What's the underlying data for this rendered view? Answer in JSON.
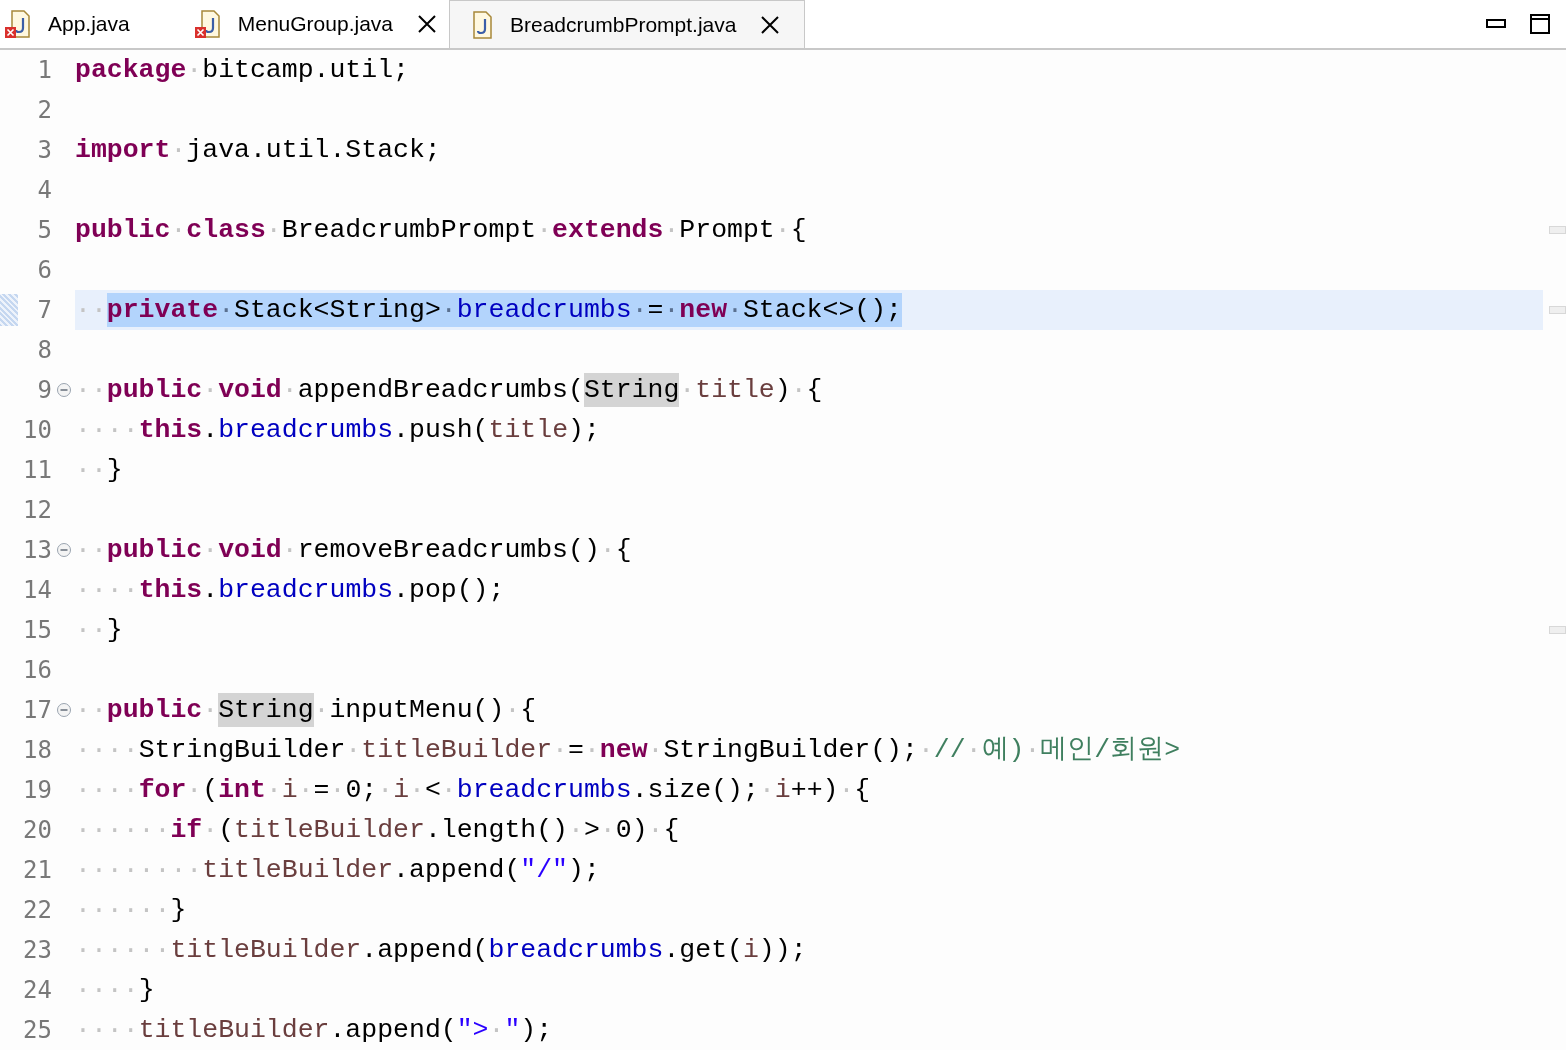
{
  "tabs": [
    {
      "label": "App.java",
      "selected": false,
      "error": true,
      "closable": false
    },
    {
      "label": "MenuGroup.java",
      "selected": false,
      "error": true,
      "closable": true
    },
    {
      "label": "BreadcrumbPrompt.java",
      "selected": true,
      "error": false,
      "closable": true
    }
  ],
  "lines": [
    {
      "number": "1",
      "tokens": [
        {
          "text": "package",
          "kind": "keyword"
        },
        {
          "text": "·",
          "kind": "ws"
        },
        {
          "text": "bitcamp.util;",
          "kind": "plain"
        }
      ]
    },
    {
      "number": "2"
    },
    {
      "number": "3",
      "tokens": [
        {
          "text": "import",
          "kind": "keyword"
        },
        {
          "text": "·",
          "kind": "ws"
        },
        {
          "text": "java.util.Stack;",
          "kind": "plain"
        }
      ]
    },
    {
      "number": "4"
    },
    {
      "number": "5",
      "ruler_mark": true,
      "tokens": [
        {
          "text": "public",
          "kind": "keyword"
        },
        {
          "text": "·",
          "kind": "ws"
        },
        {
          "text": "class",
          "kind": "keyword"
        },
        {
          "text": "·",
          "kind": "ws"
        },
        {
          "text": "BreadcrumbPrompt",
          "kind": "plain"
        },
        {
          "text": "·",
          "kind": "ws"
        },
        {
          "text": "extends",
          "kind": "keyword"
        },
        {
          "text": "·",
          "kind": "ws"
        },
        {
          "text": "Prompt",
          "kind": "plain"
        },
        {
          "text": "·",
          "kind": "ws"
        },
        {
          "text": "{",
          "kind": "plain"
        }
      ]
    },
    {
      "number": "6"
    },
    {
      "number": "7",
      "current": true,
      "ruler_mark": true,
      "tokens": [
        {
          "text": "··",
          "kind": "ws"
        },
        {
          "text": "private",
          "kind": "keyword",
          "selected": true
        },
        {
          "text": "·",
          "kind": "ws",
          "selected": true
        },
        {
          "text": "Stack<String>",
          "kind": "plain",
          "selected": true
        },
        {
          "text": "·",
          "kind": "ws",
          "selected": true
        },
        {
          "text": "breadcrumbs",
          "kind": "field",
          "selected": true
        },
        {
          "text": "·",
          "kind": "ws",
          "selected": true
        },
        {
          "text": "=",
          "kind": "plain",
          "selected": true
        },
        {
          "text": "·",
          "kind": "ws",
          "selected": true
        },
        {
          "text": "new",
          "kind": "keyword",
          "selected": true
        },
        {
          "text": "·",
          "kind": "ws",
          "selected": true
        },
        {
          "text": "Stack<>();",
          "kind": "plain",
          "selected": true
        }
      ]
    },
    {
      "number": "8"
    },
    {
      "number": "9",
      "fold": {
        "expanded": true
      },
      "tokens": [
        {
          "text": "··",
          "kind": "ws"
        },
        {
          "text": "public",
          "kind": "keyword"
        },
        {
          "text": "·",
          "kind": "ws"
        },
        {
          "text": "void",
          "kind": "keyword"
        },
        {
          "text": "·",
          "kind": "ws"
        },
        {
          "text": "appendBreadcrumbs(",
          "kind": "plain"
        },
        {
          "text": "String",
          "kind": "plain",
          "occurrence": true
        },
        {
          "text": "·",
          "kind": "ws"
        },
        {
          "text": "title",
          "kind": "local"
        },
        {
          "text": ")",
          "kind": "plain"
        },
        {
          "text": "·",
          "kind": "ws"
        },
        {
          "text": "{",
          "kind": "plain"
        }
      ]
    },
    {
      "number": "10",
      "tokens": [
        {
          "text": "····",
          "kind": "ws"
        },
        {
          "text": "this",
          "kind": "keyword"
        },
        {
          "text": ".",
          "kind": "plain"
        },
        {
          "text": "breadcrumbs",
          "kind": "field"
        },
        {
          "text": ".push(",
          "kind": "plain"
        },
        {
          "text": "title",
          "kind": "local"
        },
        {
          "text": ");",
          "kind": "plain"
        }
      ]
    },
    {
      "number": "11",
      "tokens": [
        {
          "text": "··",
          "kind": "ws"
        },
        {
          "text": "}",
          "kind": "plain"
        }
      ]
    },
    {
      "number": "12"
    },
    {
      "number": "13",
      "fold": {
        "expanded": true
      },
      "tokens": [
        {
          "text": "··",
          "kind": "ws"
        },
        {
          "text": "public",
          "kind": "keyword"
        },
        {
          "text": "·",
          "kind": "ws"
        },
        {
          "text": "void",
          "kind": "keyword"
        },
        {
          "text": "·",
          "kind": "ws"
        },
        {
          "text": "removeBreadcrumbs()",
          "kind": "plain"
        },
        {
          "text": "·",
          "kind": "ws"
        },
        {
          "text": "{",
          "kind": "plain"
        }
      ]
    },
    {
      "number": "14",
      "tokens": [
        {
          "text": "····",
          "kind": "ws"
        },
        {
          "text": "this",
          "kind": "keyword"
        },
        {
          "text": ".",
          "kind": "plain"
        },
        {
          "text": "breadcrumbs",
          "kind": "field"
        },
        {
          "text": ".pop();",
          "kind": "plain"
        }
      ]
    },
    {
      "number": "15",
      "ruler_mark": true,
      "tokens": [
        {
          "text": "··",
          "kind": "ws"
        },
        {
          "text": "}",
          "kind": "plain"
        }
      ]
    },
    {
      "number": "16"
    },
    {
      "number": "17",
      "fold": {
        "expanded": true
      },
      "tokens": [
        {
          "text": "··",
          "kind": "ws"
        },
        {
          "text": "public",
          "kind": "keyword"
        },
        {
          "text": "·",
          "kind": "ws"
        },
        {
          "text": "String",
          "kind": "plain",
          "occurrence": true
        },
        {
          "text": "·",
          "kind": "ws"
        },
        {
          "text": "inputMenu()",
          "kind": "plain"
        },
        {
          "text": "·",
          "kind": "ws"
        },
        {
          "text": "{",
          "kind": "plain"
        }
      ]
    },
    {
      "number": "18",
      "tokens": [
        {
          "text": "····",
          "kind": "ws"
        },
        {
          "text": "StringBuilder",
          "kind": "plain"
        },
        {
          "text": "·",
          "kind": "ws"
        },
        {
          "text": "titleBuilder",
          "kind": "local"
        },
        {
          "text": "·",
          "kind": "ws"
        },
        {
          "text": "=",
          "kind": "plain"
        },
        {
          "text": "·",
          "kind": "ws"
        },
        {
          "text": "new",
          "kind": "keyword"
        },
        {
          "text": "·",
          "kind": "ws"
        },
        {
          "text": "StringBuilder();",
          "kind": "plain"
        },
        {
          "text": "·",
          "kind": "ws"
        },
        {
          "text": "//",
          "kind": "comment"
        },
        {
          "text": "·",
          "kind": "ws"
        },
        {
          "text": "예)",
          "kind": "comment"
        },
        {
          "text": "·",
          "kind": "ws"
        },
        {
          "text": "메인/회원>",
          "kind": "comment"
        }
      ]
    },
    {
      "number": "19",
      "tokens": [
        {
          "text": "····",
          "kind": "ws"
        },
        {
          "text": "for",
          "kind": "keyword"
        },
        {
          "text": "·",
          "kind": "ws"
        },
        {
          "text": "(",
          "kind": "plain"
        },
        {
          "text": "int",
          "kind": "keyword"
        },
        {
          "text": "·",
          "kind": "ws"
        },
        {
          "text": "i",
          "kind": "local"
        },
        {
          "text": "·",
          "kind": "ws"
        },
        {
          "text": "=",
          "kind": "plain"
        },
        {
          "text": "·",
          "kind": "ws"
        },
        {
          "text": "0;",
          "kind": "plain"
        },
        {
          "text": "·",
          "kind": "ws"
        },
        {
          "text": "i",
          "kind": "local"
        },
        {
          "text": "·",
          "kind": "ws"
        },
        {
          "text": "<",
          "kind": "plain"
        },
        {
          "text": "·",
          "kind": "ws"
        },
        {
          "text": "breadcrumbs",
          "kind": "field"
        },
        {
          "text": ".size();",
          "kind": "plain"
        },
        {
          "text": "·",
          "kind": "ws"
        },
        {
          "text": "i",
          "kind": "local"
        },
        {
          "text": "++)",
          "kind": "plain"
        },
        {
          "text": "·",
          "kind": "ws"
        },
        {
          "text": "{",
          "kind": "plain"
        }
      ]
    },
    {
      "number": "20",
      "tokens": [
        {
          "text": "······",
          "kind": "ws"
        },
        {
          "text": "if",
          "kind": "keyword"
        },
        {
          "text": "·",
          "kind": "ws"
        },
        {
          "text": "(",
          "kind": "plain"
        },
        {
          "text": "titleBuilder",
          "kind": "local"
        },
        {
          "text": ".length()",
          "kind": "plain"
        },
        {
          "text": "·",
          "kind": "ws"
        },
        {
          "text": ">",
          "kind": "plain"
        },
        {
          "text": "·",
          "kind": "ws"
        },
        {
          "text": "0)",
          "kind": "plain"
        },
        {
          "text": "·",
          "kind": "ws"
        },
        {
          "text": "{",
          "kind": "plain"
        }
      ]
    },
    {
      "number": "21",
      "tokens": [
        {
          "text": "········",
          "kind": "ws"
        },
        {
          "text": "titleBuilder",
          "kind": "local"
        },
        {
          "text": ".append(",
          "kind": "plain"
        },
        {
          "text": "\"/\"",
          "kind": "string"
        },
        {
          "text": ");",
          "kind": "plain"
        }
      ]
    },
    {
      "number": "22",
      "tokens": [
        {
          "text": "······",
          "kind": "ws"
        },
        {
          "text": "}",
          "kind": "plain"
        }
      ]
    },
    {
      "number": "23",
      "tokens": [
        {
          "text": "······",
          "kind": "ws"
        },
        {
          "text": "titleBuilder",
          "kind": "local"
        },
        {
          "text": ".append(",
          "kind": "plain"
        },
        {
          "text": "breadcrumbs",
          "kind": "field"
        },
        {
          "text": ".get(",
          "kind": "plain"
        },
        {
          "text": "i",
          "kind": "local"
        },
        {
          "text": "));",
          "kind": "plain"
        }
      ]
    },
    {
      "number": "24",
      "tokens": [
        {
          "text": "····",
          "kind": "ws"
        },
        {
          "text": "}",
          "kind": "plain"
        }
      ]
    },
    {
      "number": "25",
      "tokens": [
        {
          "text": "····",
          "kind": "ws"
        },
        {
          "text": "titleBuilder",
          "kind": "local"
        },
        {
          "text": ".append(",
          "kind": "plain"
        },
        {
          "text": "\">",
          "kind": "string"
        },
        {
          "text": "·",
          "kind": "ws"
        },
        {
          "text": "\"",
          "kind": "string"
        },
        {
          "text": ");",
          "kind": "plain"
        }
      ]
    }
  ]
}
